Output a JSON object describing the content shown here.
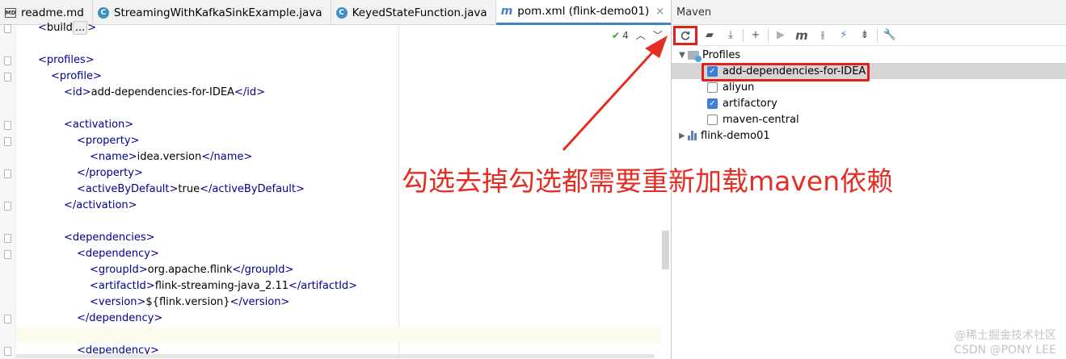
{
  "tabs": [
    {
      "label": "readme.md",
      "icon": "markdown-file-icon",
      "active": false
    },
    {
      "label": "StreamingWithKafkaSinkExample.java",
      "icon": "java-class-icon",
      "active": false
    },
    {
      "label": "KeyedStateFunction.java",
      "icon": "java-class-icon",
      "active": false
    },
    {
      "label": "pom.xml (flink-demo01)",
      "icon": "maven-file-icon",
      "active": true
    }
  ],
  "tab_close_glyph": "×",
  "editor": {
    "inspection_count": "4",
    "lines": [
      {
        "indent": 2,
        "parts": [
          [
            "tag",
            "<"
          ],
          [
            "txt",
            "build"
          ],
          [
            "tail",
            "..."
          ],
          [
            "tag",
            ">"
          ]
        ]
      },
      {
        "indent": 0,
        "parts": []
      },
      {
        "indent": 2,
        "parts": [
          [
            "tag",
            "<profiles>"
          ]
        ]
      },
      {
        "indent": 4,
        "parts": [
          [
            "tag",
            "<profile>"
          ]
        ]
      },
      {
        "indent": 6,
        "parts": [
          [
            "tag",
            "<id>"
          ],
          [
            "txt",
            "add-dependencies-for-IDEA"
          ],
          [
            "tag",
            "</id>"
          ]
        ]
      },
      {
        "indent": 0,
        "parts": []
      },
      {
        "indent": 6,
        "parts": [
          [
            "tag",
            "<activation>"
          ]
        ]
      },
      {
        "indent": 8,
        "parts": [
          [
            "tag",
            "<property>"
          ]
        ]
      },
      {
        "indent": 10,
        "parts": [
          [
            "tag",
            "<name>"
          ],
          [
            "txt",
            "idea.version"
          ],
          [
            "tag",
            "</name>"
          ]
        ]
      },
      {
        "indent": 8,
        "parts": [
          [
            "tag",
            "</property>"
          ]
        ]
      },
      {
        "indent": 8,
        "parts": [
          [
            "tag",
            "<activeByDefault>"
          ],
          [
            "txt",
            "true"
          ],
          [
            "tag",
            "</activeByDefault>"
          ]
        ]
      },
      {
        "indent": 6,
        "parts": [
          [
            "tag",
            "</activation>"
          ]
        ]
      },
      {
        "indent": 0,
        "parts": []
      },
      {
        "indent": 6,
        "parts": [
          [
            "tag",
            "<dependencies>"
          ]
        ]
      },
      {
        "indent": 8,
        "parts": [
          [
            "tag",
            "<dependency>"
          ]
        ]
      },
      {
        "indent": 10,
        "parts": [
          [
            "tag",
            "<groupId>"
          ],
          [
            "txt",
            "org.apache.flink"
          ],
          [
            "tag",
            "</groupId>"
          ]
        ]
      },
      {
        "indent": 10,
        "parts": [
          [
            "tag",
            "<artifactId>"
          ],
          [
            "txt",
            "flink-streaming-java_2.11"
          ],
          [
            "tag",
            "</artifactId>"
          ]
        ]
      },
      {
        "indent": 10,
        "parts": [
          [
            "tag",
            "<version>"
          ],
          [
            "txt",
            "${flink.version}"
          ],
          [
            "tag",
            "</version>"
          ]
        ]
      },
      {
        "indent": 8,
        "parts": [
          [
            "tag",
            "</dependency>"
          ]
        ]
      },
      {
        "indent": 0,
        "parts": []
      },
      {
        "indent": 8,
        "parts": [
          [
            "tag",
            "<dependency>"
          ]
        ]
      }
    ]
  },
  "maven": {
    "title": "Maven",
    "tree": {
      "profiles_label": "Profiles",
      "profiles": [
        {
          "name": "add-dependencies-for-IDEA",
          "checked": true,
          "selected": true
        },
        {
          "name": "aliyun",
          "checked": false,
          "selected": false
        },
        {
          "name": "artifactory",
          "checked": true,
          "selected": false
        },
        {
          "name": "maven-central",
          "checked": false,
          "selected": false
        }
      ],
      "module_label": "flink-demo01"
    }
  },
  "annotation": {
    "text": "勾选去掉勾选都需要重新加载maven依赖",
    "color": "#e52e23"
  },
  "watermark": {
    "line1": "@稀土掘金技术社区",
    "line2": "CSDN @PONY LEE"
  }
}
